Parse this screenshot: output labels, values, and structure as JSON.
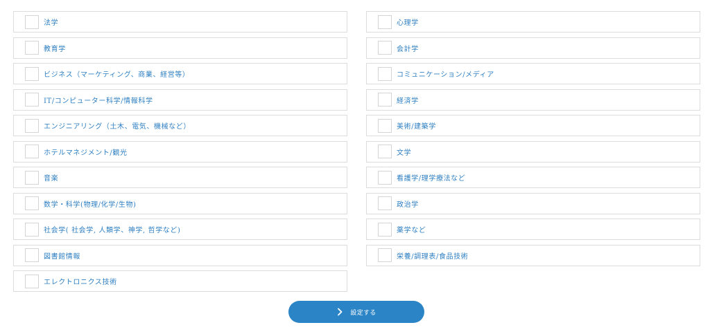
{
  "left_options": [
    {
      "label": "法学",
      "checked": false
    },
    {
      "label": "教育学",
      "checked": false
    },
    {
      "label": "ビジネス（マーケティング、商業、経営等）",
      "checked": false
    },
    {
      "label": "IT/コンピューター科学/情報科学",
      "checked": false
    },
    {
      "label": "エンジニアリング（土木、電気、機械など）",
      "checked": false
    },
    {
      "label": "ホテルマネジメント/観光",
      "checked": false
    },
    {
      "label": "音楽",
      "checked": false
    },
    {
      "label": "数学・科学(物理/化学/生物)",
      "checked": false
    },
    {
      "label": "社会学( 社会学, 人類学、神学, 哲学など)",
      "checked": false
    },
    {
      "label": "図書館情報",
      "checked": false
    },
    {
      "label": "エレクトロニクス技術",
      "checked": false
    }
  ],
  "right_options": [
    {
      "label": "心理学",
      "checked": false
    },
    {
      "label": "会計学",
      "checked": false
    },
    {
      "label": "コミュニケーション/メディア",
      "checked": false
    },
    {
      "label": "経済学",
      "checked": false
    },
    {
      "label": "美術/建築学",
      "checked": false
    },
    {
      "label": "文学",
      "checked": false
    },
    {
      "label": "看護学/理学療法など",
      "checked": false
    },
    {
      "label": "政治学",
      "checked": false
    },
    {
      "label": "薬学など",
      "checked": false
    },
    {
      "label": "栄養/調理表/食品技術",
      "checked": false
    }
  ],
  "submit": {
    "label": "設定する",
    "icon": "chevron-right-icon"
  },
  "colors": {
    "accent": "#2a84c6",
    "label_text": "#2e7fc2",
    "border": "#dcdcdc"
  }
}
